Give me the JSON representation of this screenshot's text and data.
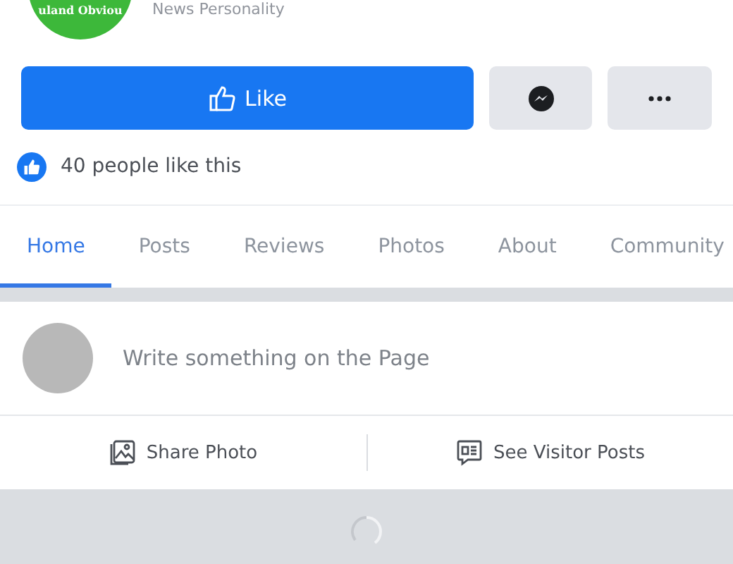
{
  "page": {
    "logo_text": "uland Obviou",
    "category": "News Personality"
  },
  "actions": {
    "like": "Like"
  },
  "likes": {
    "text": "40 people like this"
  },
  "tabs": [
    {
      "label": "Home",
      "selected": true
    },
    {
      "label": "Posts",
      "selected": false
    },
    {
      "label": "Reviews",
      "selected": false
    },
    {
      "label": "Photos",
      "selected": false
    },
    {
      "label": "About",
      "selected": false
    },
    {
      "label": "Community",
      "selected": false
    }
  ],
  "composer": {
    "placeholder": "Write something on the Page"
  },
  "composer_actions": [
    {
      "kind": "photo",
      "label": "Share Photo"
    },
    {
      "kind": "visitor",
      "label": "See Visitor Posts"
    }
  ],
  "feed": {
    "loading": true
  }
}
